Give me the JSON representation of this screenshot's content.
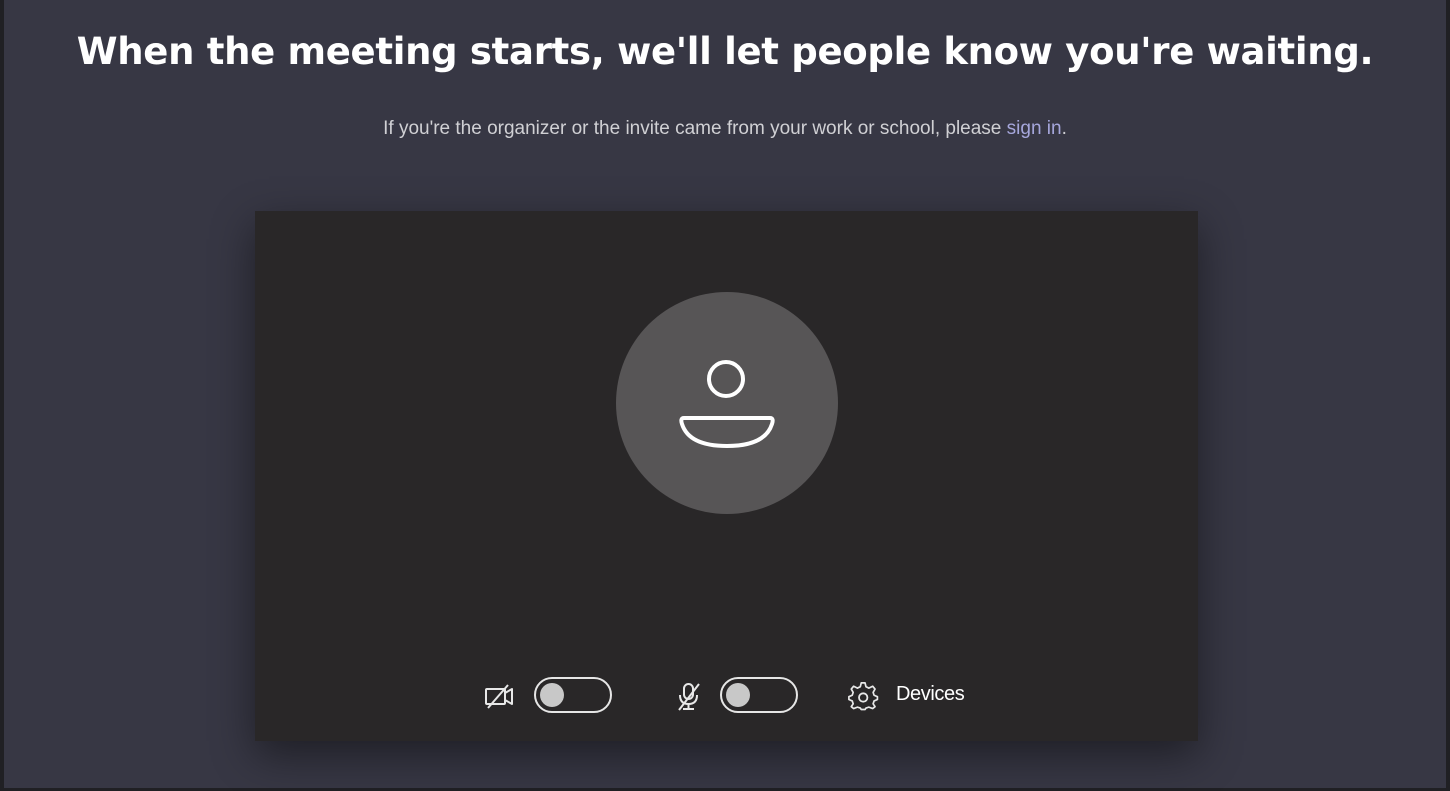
{
  "header": {
    "title": "When the meeting starts, we'll let people know you're waiting.",
    "subtitle_prefix": "If you're the organizer or the invite came from your work or school, please ",
    "sign_in_link": "sign in",
    "subtitle_suffix": "."
  },
  "preview": {
    "avatar_icon": "person-icon",
    "controls": {
      "camera": {
        "icon": "camera-off-icon",
        "toggle_on": false
      },
      "microphone": {
        "icon": "mic-off-icon",
        "toggle_on": false
      },
      "devices": {
        "icon": "gear-icon",
        "label": "Devices"
      }
    }
  },
  "colors": {
    "background": "#373744",
    "preview_background": "#292728",
    "avatar_circle": "#575556",
    "link": "#a6a7dc",
    "toggle_border": "#e6e6e6",
    "toggle_knob": "#c8c8c8"
  }
}
